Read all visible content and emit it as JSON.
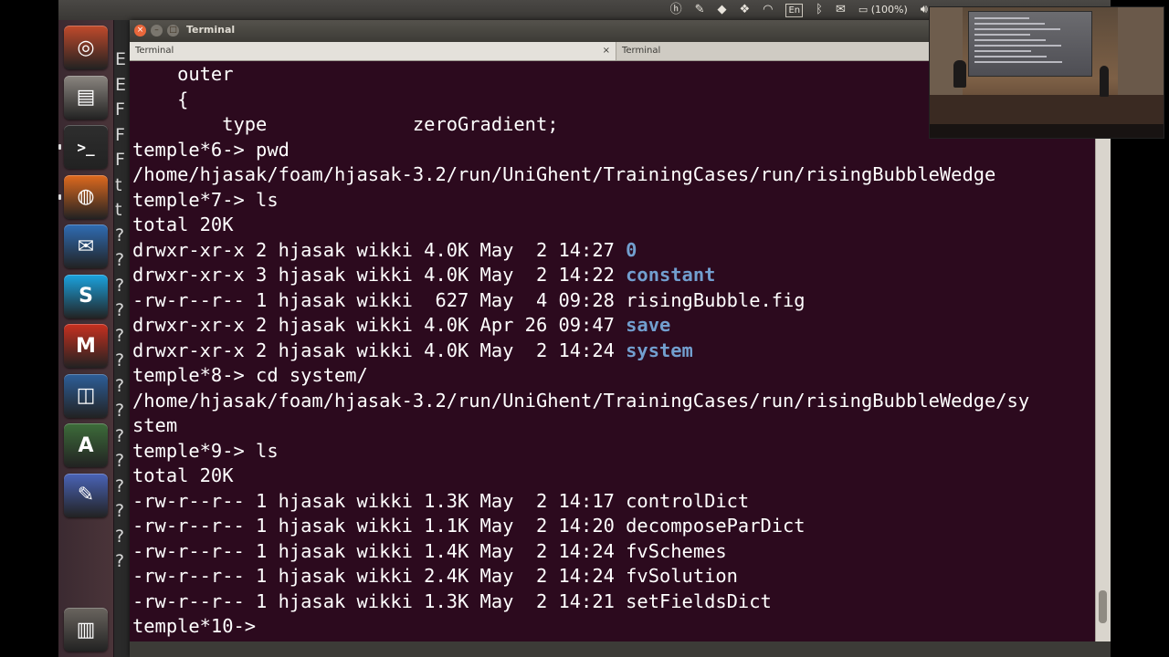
{
  "panel": {
    "window_label": "Terminal",
    "keyboard_layout": "En",
    "battery": "(100%)"
  },
  "window": {
    "title": "Terminal",
    "tabs": [
      {
        "label": "Terminal",
        "close": "×"
      },
      {
        "label": "Terminal"
      }
    ]
  },
  "behind_window_text": [
    "E",
    "E",
    "F",
    "F",
    "F",
    "t",
    "t",
    "?",
    "?",
    "?",
    "?",
    "?",
    "?",
    "?",
    "?",
    "?",
    "?",
    "?",
    "?",
    "?",
    "?"
  ],
  "terminal": {
    "lines": [
      {
        "text": "    outer"
      },
      {
        "text": "    {"
      },
      {
        "text": "        type             zeroGradient;"
      },
      {
        "text": "temple*6-> pwd"
      },
      {
        "text": "/home/hjasak/foam/hjasak-3.2/run/UniGhent/TrainingCases/run/risingBubbleWedge"
      },
      {
        "text": "temple*7-> ls"
      },
      {
        "text": "total 20K"
      },
      {
        "text": "drwxr-xr-x 2 hjasak wikki 4.0K May  2 14:27 ",
        "name": "0",
        "dir": true
      },
      {
        "text": "drwxr-xr-x 3 hjasak wikki 4.0K May  2 14:22 ",
        "name": "constant",
        "dir": true
      },
      {
        "text": "-rw-r--r-- 1 hjasak wikki  627 May  4 09:28 ",
        "name": "risingBubble.fig",
        "dir": false
      },
      {
        "text": "drwxr-xr-x 2 hjasak wikki 4.0K Apr 26 09:47 ",
        "name": "save",
        "dir": true
      },
      {
        "text": "drwxr-xr-x 2 hjasak wikki 4.0K May  2 14:24 ",
        "name": "system",
        "dir": true
      },
      {
        "text": "temple*8-> cd system/"
      },
      {
        "text": "/home/hjasak/foam/hjasak-3.2/run/UniGhent/TrainingCases/run/risingBubbleWedge/sy"
      },
      {
        "text": "stem"
      },
      {
        "text": "temple*9-> ls"
      },
      {
        "text": "total 20K"
      },
      {
        "text": "-rw-r--r-- 1 hjasak wikki 1.3K May  2 14:17 ",
        "name": "controlDict",
        "dir": false
      },
      {
        "text": "-rw-r--r-- 1 hjasak wikki 1.1K May  2 14:20 ",
        "name": "decomposeParDict",
        "dir": false
      },
      {
        "text": "-rw-r--r-- 1 hjasak wikki 1.4K May  2 14:24 ",
        "name": "fvSchemes",
        "dir": false
      },
      {
        "text": "-rw-r--r-- 1 hjasak wikki 2.4K May  2 14:24 ",
        "name": "fvSolution",
        "dir": false
      },
      {
        "text": "-rw-r--r-- 1 hjasak wikki 1.3K May  2 14:21 ",
        "name": "setFieldsDict",
        "dir": false
      },
      {
        "text": "temple*10-> "
      }
    ],
    "scroll_position": 0.97
  },
  "launcher_icons": [
    "ubuntu-dash-icon",
    "file-manager-icon",
    "terminal-icon",
    "firefox-icon",
    "thunderbird-icon",
    "skype-icon",
    "matlab-icon",
    "virtualbox-icon",
    "software-updater-icon",
    "text-editor-icon",
    "trash-icon"
  ],
  "colors": {
    "terminal_bg": "#2c0a1e",
    "terminal_fg": "#ffffff",
    "directory": "#729fcf"
  }
}
